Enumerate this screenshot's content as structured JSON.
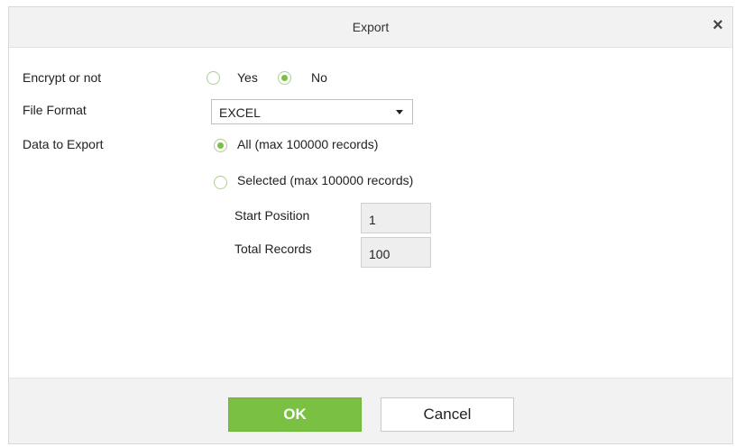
{
  "dialog": {
    "title": "Export",
    "close_symbol": "×"
  },
  "form": {
    "encrypt": {
      "label": "Encrypt or not",
      "options": [
        {
          "label": "Yes",
          "checked": false
        },
        {
          "label": "No",
          "checked": true
        }
      ]
    },
    "file_format": {
      "label": "File Format",
      "selected": "EXCEL"
    },
    "data_to_export": {
      "label": "Data to Export",
      "options": [
        {
          "label": "All (max 100000 records)",
          "checked": true
        },
        {
          "label": "Selected (max 100000 records)",
          "checked": false
        }
      ],
      "start_position": {
        "label": "Start Position",
        "value": "1"
      },
      "total_records": {
        "label": "Total Records",
        "value": "100"
      }
    }
  },
  "buttons": {
    "ok": "OK",
    "cancel": "Cancel"
  },
  "icons": {
    "close": "close-icon",
    "dropdown": "chevron-down-icon"
  },
  "colors": {
    "accent": "#7ac143",
    "header_bg": "#f2f2f2",
    "field_bg": "#eeeeee"
  }
}
